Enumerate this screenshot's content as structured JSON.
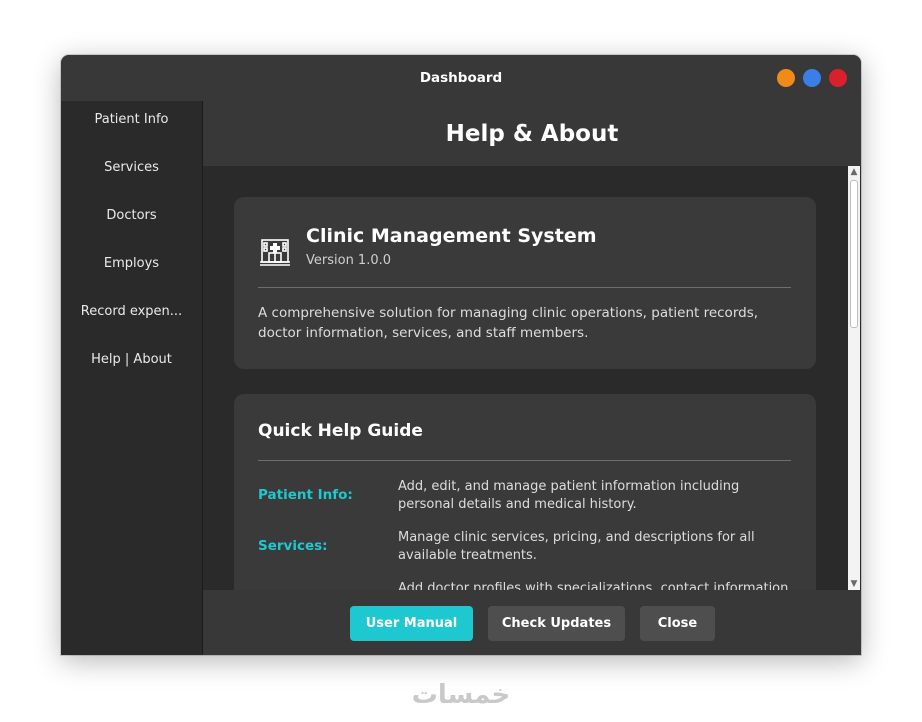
{
  "window": {
    "title": "Dashboard"
  },
  "sidebar": {
    "items": [
      {
        "label": "Patient Info"
      },
      {
        "label": "Services"
      },
      {
        "label": "Doctors"
      },
      {
        "label": "Employs"
      },
      {
        "label": "Record expen..."
      },
      {
        "label": "Help | About"
      }
    ]
  },
  "page": {
    "title": "Help & About"
  },
  "about": {
    "app_name": "Clinic Management System",
    "version": "Version 1.0.0",
    "description": "A comprehensive solution for managing clinic operations, patient records, doctor information, services, and staff members.",
    "icon": "hospital-icon"
  },
  "help": {
    "title": "Quick Help Guide",
    "items": [
      {
        "key": "Patient Info:",
        "text": "Add, edit, and manage patient information including personal details and medical history."
      },
      {
        "key": "Services:",
        "text": "Manage clinic services, pricing, and descriptions for all available treatments."
      },
      {
        "key": "Doctors:",
        "text": "Add doctor profiles with specializations, contact information"
      }
    ]
  },
  "footer": {
    "user_manual": "User Manual",
    "check_updates": "Check Updates",
    "close": "Close"
  },
  "watermark": "خمسات",
  "colors": {
    "accent": "#1ec8d0",
    "background": "#2a2a2a",
    "panel": "#383838",
    "card": "#3a3a3a"
  }
}
